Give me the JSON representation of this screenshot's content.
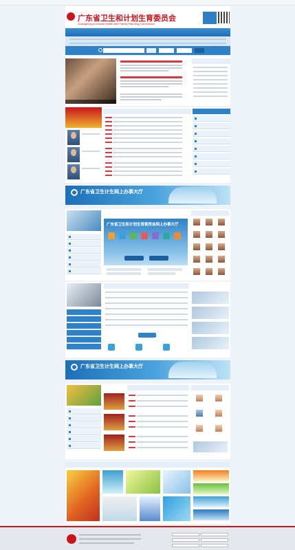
{
  "topbar": {
    "left": "",
    "right": ""
  },
  "header": {
    "title": "广东省卫生和计划生育委员会",
    "subtitle": "Guangdong provincial Health and Family Planning Commission",
    "qr_label": ""
  },
  "nav": {
    "items": [
      "",
      "",
      "",
      "",
      "",
      ""
    ]
  },
  "search": {
    "placeholder": "",
    "button": "",
    "select1": "",
    "select2": "",
    "go": ""
  },
  "photo_caption": "",
  "headlines": [
    ""
  ],
  "banner1": {
    "title": "广东省卫生计生网上办事大厅",
    "subtitle": ""
  },
  "service_hall": {
    "title": "广东省卫生和计划生育委员会网上办事大厅",
    "button": ""
  },
  "banner2": {
    "title": "广东省卫生计生网上办事大厅",
    "subtitle": ""
  },
  "section_labels": {
    "leaders": "",
    "right_tools": "",
    "special": ""
  },
  "colors": {
    "accent": "#2f82c7",
    "brand_red": "#c8161d",
    "nav_blue": "#1f6fb8"
  },
  "icons": [
    "search-icon",
    "qr-code-icon",
    "emblem-icon"
  ]
}
